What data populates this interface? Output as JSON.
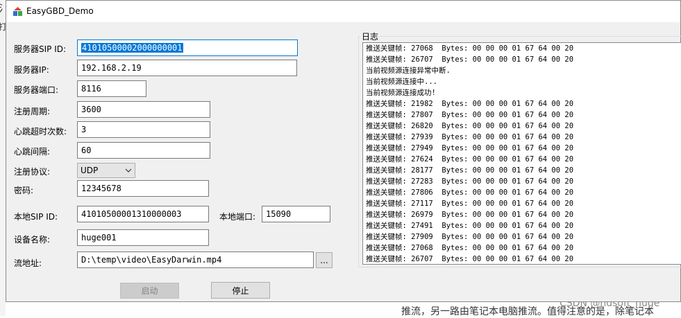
{
  "background": {
    "left_fragment_1": "氵",
    "left_fragment_2": "打",
    "bottom_text": "推流，另一路由笔记本电脑推流。值得注意的是，除笔记本",
    "watermark": "CSDN @hdsoft_huge"
  },
  "window": {
    "title": "EasyGBD_Demo",
    "icon": "app-icon"
  },
  "form": {
    "server_sip_id": {
      "label": "服务器SIP ID:",
      "value": "41010500002000000001"
    },
    "server_ip": {
      "label": "服务器IP:",
      "value": "192.168.2.19"
    },
    "server_port": {
      "label": "服务器端口:",
      "value": "8116"
    },
    "register_period": {
      "label": "注册周期:",
      "value": "3600"
    },
    "heartbeat_timeouts": {
      "label": "心跳超时次数:",
      "value": "3"
    },
    "heartbeat_interval": {
      "label": "心跳间隔:",
      "value": "60"
    },
    "register_protocol": {
      "label": "注册协议:",
      "value": "UDP"
    },
    "password": {
      "label": "密码:",
      "value": "12345678"
    },
    "local_sip_id": {
      "label": "本地SIP ID:",
      "value": "41010500001310000003"
    },
    "local_port": {
      "label": "本地端口:",
      "value": "15090"
    },
    "device_name": {
      "label": "设备名称:",
      "value": "huge001"
    },
    "stream_address": {
      "label": "流地址:",
      "value": "D:\\temp\\video\\EasyDarwin.mp4",
      "browse_label": "..."
    },
    "start_button": "启动",
    "stop_button": "停止"
  },
  "log": {
    "title": "日志",
    "lines": [
      "推送关键帧: 27068  Bytes: 00 00 00 01 67 64 00 20",
      "推送关键帧: 26707  Bytes: 00 00 00 01 67 64 00 20",
      "当前视频源连接异常中断.",
      "当前视频源连接中...",
      "当前视频源连接成功!",
      "推送关键帧: 21982  Bytes: 00 00 00 01 67 64 00 20",
      "推送关键帧: 27807  Bytes: 00 00 00 01 67 64 00 20",
      "推送关键帧: 26820  Bytes: 00 00 00 01 67 64 00 20",
      "推送关键帧: 27939  Bytes: 00 00 00 01 67 64 00 20",
      "推送关键帧: 27949  Bytes: 00 00 00 01 67 64 00 20",
      "推送关键帧: 27624  Bytes: 00 00 00 01 67 64 00 20",
      "推送关键帧: 28177  Bytes: 00 00 00 01 67 64 00 20",
      "推送关键帧: 27283  Bytes: 00 00 00 01 67 64 00 20",
      "推送关键帧: 27806  Bytes: 00 00 00 01 67 64 00 20",
      "推送关键帧: 27117  Bytes: 00 00 00 01 67 64 00 20",
      "推送关键帧: 26979  Bytes: 00 00 00 01 67 64 00 20",
      "推送关键帧: 27491  Bytes: 00 00 00 01 67 64 00 20",
      "推送关键帧: 27909  Bytes: 00 00 00 01 67 64 00 20",
      "推送关键帧: 27068  Bytes: 00 00 00 01 67 64 00 20",
      "推送关键帧: 26707  Bytes: 00 00 00 01 67 64 00 20"
    ]
  }
}
